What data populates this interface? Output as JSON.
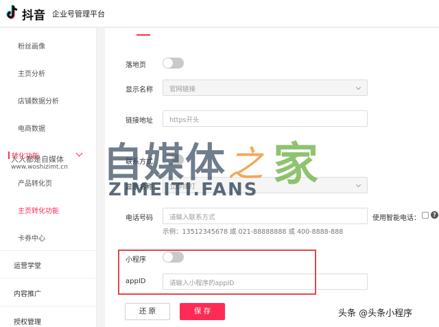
{
  "app": {
    "logo_text": "抖音",
    "platform_name": "企业号管理平台"
  },
  "sidebar": {
    "items": [
      {
        "label": "粉丝画像"
      },
      {
        "label": "主页分析"
      },
      {
        "label": "店铺数据分析"
      },
      {
        "label": "电商数据"
      }
    ],
    "group": {
      "label": "转化功能"
    },
    "sub_items": [
      {
        "label": "产品转化页"
      },
      {
        "label": "主页转化功能"
      },
      {
        "label": "卡券中心"
      }
    ],
    "sections": [
      {
        "label": "运营学堂"
      },
      {
        "label": "内容推广"
      },
      {
        "label": "授权管理"
      }
    ]
  },
  "form": {
    "landing_label": "落地页",
    "display_name_label": "显示名称",
    "display_name_value": "官网链接",
    "link_label": "链接地址",
    "link_placeholder": "https开头",
    "contact_label": "联系方式",
    "display_name2_label": "显示名称",
    "display_name2_value": "立即拨打",
    "phone_label": "电话号码",
    "phone_placeholder": "请输入联系方式",
    "smart_phone_label": "使用智能电话：",
    "phone_example": "示例：13512345678 或 021-88888888 或 400-8888-888",
    "miniprogram_label": "小程序",
    "appid_label": "appID",
    "appid_placeholder": "请输入小程序的appID"
  },
  "buttons": {
    "reset": "还 原",
    "save": "保 存"
  },
  "watermark": {
    "big_text": "自媒体",
    "glyph": "之",
    "home": "家",
    "domain": "ZIMEITI.FANS",
    "small_cn": "人人都是自媒体",
    "small_url": "www.woshizimt.cn",
    "author": "头条 @头条小程序"
  },
  "colors": {
    "accent": "#fe2c55",
    "highlight_border": "#e0454b",
    "toggle_off": "#c9c9c9"
  },
  "icons": [
    "douyin-logo-icon",
    "chevron-down-icon",
    "select-arrow-icon",
    "help-icon"
  ]
}
